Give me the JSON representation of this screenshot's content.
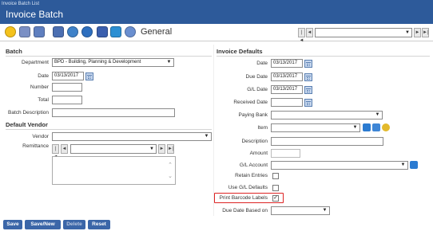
{
  "header": {
    "breadcrumb": "Invoice Batch List",
    "title": "Invoice Batch"
  },
  "toolbar": {
    "view_label": "General",
    "icons": [
      "new-icon",
      "cards-icon",
      "badge-icon",
      "wrench-icon",
      "target-icon",
      "disc-icon",
      "check-icon",
      "bag-icon",
      "no-icon"
    ],
    "pager": {
      "first": "|◄",
      "prev": "◄",
      "next": "►",
      "last": "►|",
      "record": ""
    }
  },
  "batch": {
    "section_label": "Batch",
    "department": {
      "label": "Department",
      "value": "BPD - Building, Planning & Development"
    },
    "date": {
      "label": "Date",
      "value": "03/13/2017"
    },
    "number": {
      "label": "Number",
      "value": ""
    },
    "total": {
      "label": "Total",
      "value": ""
    },
    "description": {
      "label": "Batch Description",
      "value": ""
    }
  },
  "vendor": {
    "section_label": "Default Vendor",
    "vendor": {
      "label": "Vendor",
      "value": ""
    },
    "remittance": {
      "label": "Remittance",
      "value": ""
    }
  },
  "defaults": {
    "section_label": "Invoice Defaults",
    "date": {
      "label": "Date",
      "value": "03/13/2017"
    },
    "due_date": {
      "label": "Due Date",
      "value": "03/13/2017"
    },
    "gl_date": {
      "label": "G/L Date",
      "value": "03/13/2017"
    },
    "received_date": {
      "label": "Received Date",
      "value": ""
    },
    "paying_bank": {
      "label": "Paying Bank",
      "value": ""
    },
    "item": {
      "label": "Item",
      "value": ""
    },
    "description": {
      "label": "Description",
      "value": ""
    },
    "amount": {
      "label": "Amount",
      "value": ""
    },
    "gl_account": {
      "label": "G/L Account",
      "value": ""
    },
    "retain_entries": {
      "label": "Retain Entries",
      "checked": false
    },
    "use_gl_defaults": {
      "label": "Use G/L Defaults",
      "checked": false
    },
    "print_barcode": {
      "label": "Print Barcode Labels",
      "checked": true,
      "mark": "✓"
    },
    "due_date_based_on": {
      "label": "Due Date Based on",
      "value": ""
    }
  },
  "buttons": {
    "save": "Save",
    "save_new": "Save/New",
    "delete": "Delete",
    "reset": "Reset"
  },
  "colors": {
    "header_bg": "#2d5a9a",
    "button_bg": "#3b66a8",
    "highlight": "#dd2222"
  }
}
